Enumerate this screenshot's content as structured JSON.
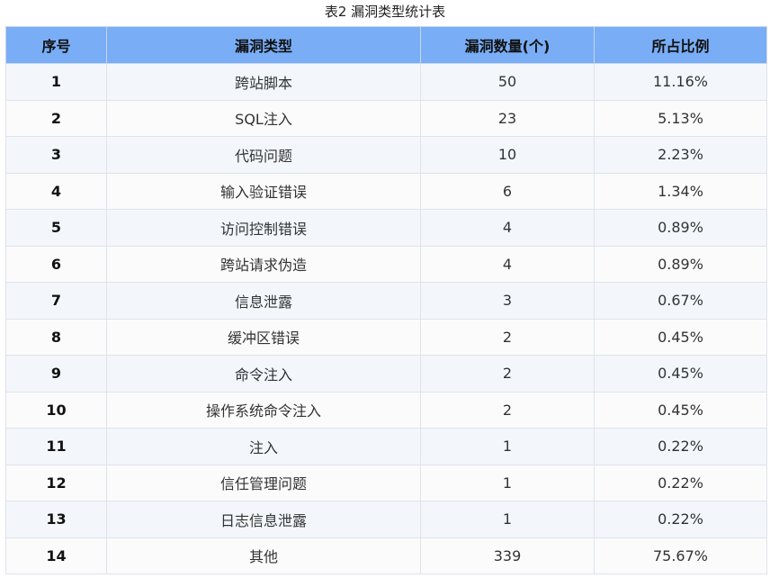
{
  "caption": "表2 漏洞类型统计表",
  "table": {
    "headers": [
      "序号",
      "漏洞类型",
      "漏洞数量(个)",
      "所占比例"
    ],
    "rows": [
      [
        "1",
        "跨站脚本",
        "50",
        "11.16%"
      ],
      [
        "2",
        "SQL注入",
        "23",
        "5.13%"
      ],
      [
        "3",
        "代码问题",
        "10",
        "2.23%"
      ],
      [
        "4",
        "输入验证错误",
        "6",
        "1.34%"
      ],
      [
        "5",
        "访问控制错误",
        "4",
        "0.89%"
      ],
      [
        "6",
        "跨站请求伪造",
        "4",
        "0.89%"
      ],
      [
        "7",
        "信息泄露",
        "3",
        "0.67%"
      ],
      [
        "8",
        "缓冲区错误",
        "2",
        "0.45%"
      ],
      [
        "9",
        "命令注入",
        "2",
        "0.45%"
      ],
      [
        "10",
        "操作系统命令注入",
        "2",
        "0.45%"
      ],
      [
        "11",
        "注入",
        "1",
        "0.22%"
      ],
      [
        "12",
        "信任管理问题",
        "1",
        "0.22%"
      ],
      [
        "13",
        "日志信息泄露",
        "1",
        "0.22%"
      ],
      [
        "14",
        "其他",
        "339",
        "75.67%"
      ]
    ]
  },
  "colors": {
    "header_bg": "#79adf5",
    "row_odd_bg": "#f3f7fc",
    "row_even_bg": "#fbfbfc"
  }
}
